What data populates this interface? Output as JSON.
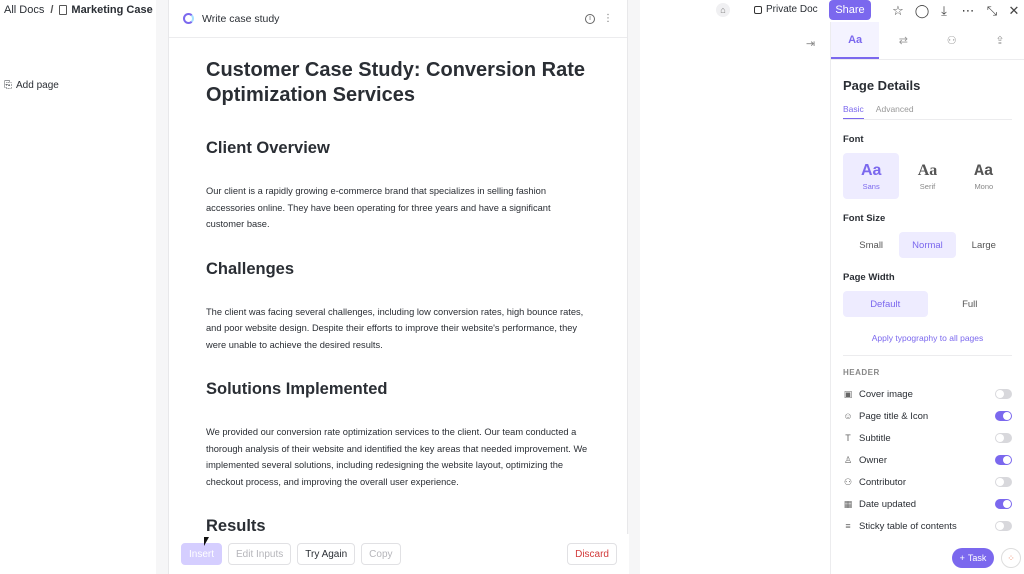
{
  "breadcrumb": {
    "root": "All Docs",
    "separator": "/",
    "doc": "Marketing Case Stud"
  },
  "topbar": {
    "private_label": "Private Doc",
    "share_label": "Share"
  },
  "left": {
    "add_page": "Add page"
  },
  "ai": {
    "title": "Write case study",
    "article": {
      "title": "Customer Case Study: Conversion Rate Optimization Services",
      "sections": [
        {
          "heading": "Client Overview",
          "body": "Our client is a rapidly growing e-commerce brand that specializes in selling fashion accessories online. They have been operating for three years and have a significant customer base."
        },
        {
          "heading": "Challenges",
          "body": "The client was facing several challenges, including low conversion rates, high bounce rates, and poor website design. Despite their efforts to improve their website's performance, they were unable to achieve the desired results."
        },
        {
          "heading": "Solutions Implemented",
          "body": "We provided our conversion rate optimization services to the client. Our team conducted a thorough analysis of their website and identified the key areas that needed improvement. We implemented several solutions, including redesigning the website layout, optimizing the checkout process, and improving the overall user experience."
        },
        {
          "heading": "Results",
          "body": ""
        }
      ]
    },
    "actions": {
      "insert": "Insert",
      "edit_inputs": "Edit Inputs",
      "try_again": "Try Again",
      "copy": "Copy",
      "discard": "Discard"
    }
  },
  "panel": {
    "tabs": [
      "Aa"
    ],
    "title": "Page Details",
    "subtabs": {
      "basic": "Basic",
      "advanced": "Advanced"
    },
    "font_label": "Font",
    "fonts": [
      {
        "glyph": "Aa",
        "name": "Sans",
        "active": true
      },
      {
        "glyph": "Aa",
        "name": "Serif",
        "active": false
      },
      {
        "glyph": "Aa",
        "name": "Mono",
        "active": false
      }
    ],
    "font_size_label": "Font Size",
    "sizes": {
      "small": "Small",
      "normal": "Normal",
      "large": "Large"
    },
    "page_width_label": "Page Width",
    "widths": {
      "default": "Default",
      "full": "Full"
    },
    "apply_link": "Apply typography to all pages",
    "header_label": "HEADER",
    "toggles": [
      {
        "label": "Cover image",
        "on": false
      },
      {
        "label": "Page title & Icon",
        "on": true
      },
      {
        "label": "Subtitle",
        "on": false
      },
      {
        "label": "Owner",
        "on": true
      },
      {
        "label": "Contributor",
        "on": false
      },
      {
        "label": "Date updated",
        "on": true
      },
      {
        "label": "Sticky table of contents",
        "on": false
      }
    ]
  },
  "floating": {
    "task_label": "Task"
  },
  "colors": {
    "accent": "#7b68ee",
    "danger": "#d33b3b"
  }
}
